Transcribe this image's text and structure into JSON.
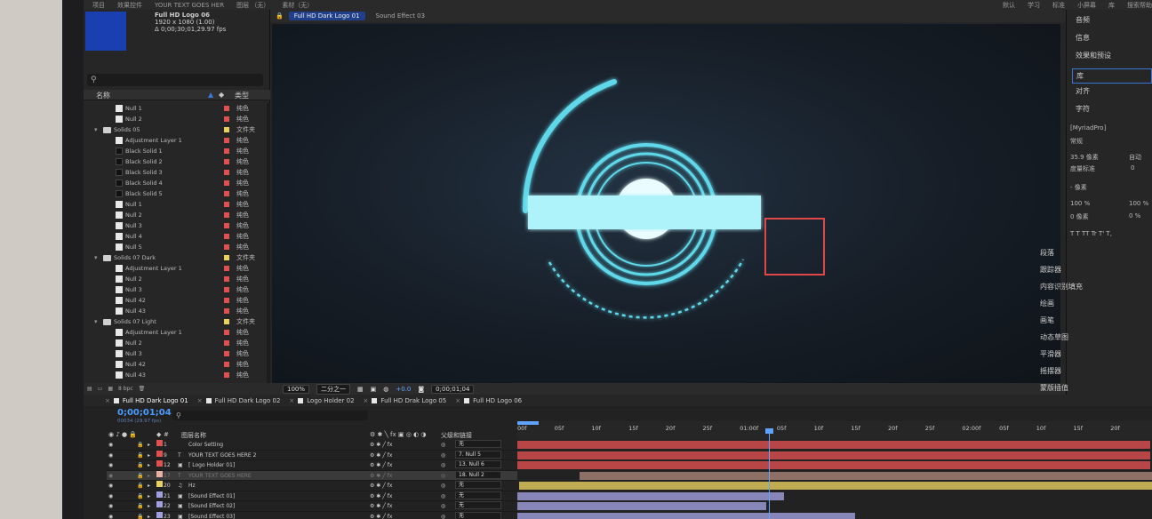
{
  "topbar": {
    "items": [
      "项目",
      "效果控件",
      "YOUR TEXT GOES HER",
      "图层 （无）",
      "素材（无）",
      "默认",
      "学习",
      "标准",
      "小屏幕",
      "库",
      "搜索帮助"
    ]
  },
  "project": {
    "comp_name": "Full HD Logo 06",
    "comp_size": "1920 x 1080 (1.00)",
    "comp_duration": "Δ 0;00;30;01,29.97 fps",
    "search_placeholder": "",
    "col_name": "名称",
    "col_type": "类型",
    "bpc": "8 bpc",
    "items": [
      {
        "indent": 1,
        "kind": "solid",
        "name": "Null 1",
        "color": "#e05050",
        "type": "纯色"
      },
      {
        "indent": 1,
        "kind": "solid",
        "name": "Null 2",
        "color": "#e05050",
        "type": "纯色"
      },
      {
        "indent": 0,
        "kind": "folder",
        "name": "Solids 05",
        "color": "#e8d060",
        "type": "文件夹"
      },
      {
        "indent": 1,
        "kind": "solid",
        "name": "Adjustment Layer 1",
        "color": "#e05050",
        "type": "纯色"
      },
      {
        "indent": 1,
        "kind": "black",
        "name": "Black Solid 1",
        "color": "#e05050",
        "type": "纯色"
      },
      {
        "indent": 1,
        "kind": "black",
        "name": "Black Solid 2",
        "color": "#e05050",
        "type": "纯色"
      },
      {
        "indent": 1,
        "kind": "black",
        "name": "Black Solid 3",
        "color": "#e05050",
        "type": "纯色"
      },
      {
        "indent": 1,
        "kind": "black",
        "name": "Black Solid 4",
        "color": "#e05050",
        "type": "纯色"
      },
      {
        "indent": 1,
        "kind": "black",
        "name": "Black Solid 5",
        "color": "#e05050",
        "type": "纯色"
      },
      {
        "indent": 1,
        "kind": "solid",
        "name": "Null 1",
        "color": "#e05050",
        "type": "纯色"
      },
      {
        "indent": 1,
        "kind": "solid",
        "name": "Null 2",
        "color": "#e05050",
        "type": "纯色"
      },
      {
        "indent": 1,
        "kind": "solid",
        "name": "Null 3",
        "color": "#e05050",
        "type": "纯色"
      },
      {
        "indent": 1,
        "kind": "solid",
        "name": "Null 4",
        "color": "#e05050",
        "type": "纯色"
      },
      {
        "indent": 1,
        "kind": "solid",
        "name": "Null 5",
        "color": "#e05050",
        "type": "纯色"
      },
      {
        "indent": 0,
        "kind": "folder",
        "name": "Solids 07 Dark",
        "color": "#e8d060",
        "type": "文件夹"
      },
      {
        "indent": 1,
        "kind": "solid",
        "name": "Adjustment Layer 1",
        "color": "#e05050",
        "type": "纯色"
      },
      {
        "indent": 1,
        "kind": "solid",
        "name": "Null 2",
        "color": "#e05050",
        "type": "纯色"
      },
      {
        "indent": 1,
        "kind": "solid",
        "name": "Null 3",
        "color": "#e05050",
        "type": "纯色"
      },
      {
        "indent": 1,
        "kind": "solid",
        "name": "Null 42",
        "color": "#e05050",
        "type": "纯色"
      },
      {
        "indent": 1,
        "kind": "solid",
        "name": "Null 43",
        "color": "#e05050",
        "type": "纯色"
      },
      {
        "indent": 0,
        "kind": "folder",
        "name": "Solids 07 Light",
        "color": "#e8d060",
        "type": "文件夹"
      },
      {
        "indent": 1,
        "kind": "solid",
        "name": "Adjustment Layer 1",
        "color": "#e05050",
        "type": "纯色"
      },
      {
        "indent": 1,
        "kind": "solid",
        "name": "Null 2",
        "color": "#e05050",
        "type": "纯色"
      },
      {
        "indent": 1,
        "kind": "solid",
        "name": "Null 3",
        "color": "#e05050",
        "type": "纯色"
      },
      {
        "indent": 1,
        "kind": "solid",
        "name": "Null 42",
        "color": "#e05050",
        "type": "纯色"
      },
      {
        "indent": 1,
        "kind": "solid",
        "name": "Null 43",
        "color": "#e05050",
        "type": "纯色"
      }
    ]
  },
  "composition": {
    "tabs": [
      "Full HD Dark Logo 01",
      "Sound Effect 03"
    ],
    "active_tab": "Full HD Dark Logo 01",
    "zoom": "100%",
    "resolution": "二分之一",
    "exposure": "+0.0",
    "timecode": "0;00;01;04",
    "accent": "#5fd8ea"
  },
  "right_panel": {
    "items": [
      "音频",
      "信息",
      "效果和预设",
      "库",
      "对齐",
      "字符"
    ],
    "selected": "库",
    "font": "[MyriadPro]",
    "style": "常规",
    "size": "35.9 像素",
    "leading": "自动",
    "tracking_label": "度量标准",
    "tracking": "0",
    "stroke": "- 像素",
    "vscale": "100 %",
    "hscale": "100 %",
    "baseline": "0 像素",
    "tsume": "0 %",
    "styles": "T T TT Tr T' T,",
    "panels": [
      "段落",
      "跟踪器",
      "内容识别填充",
      "绘画",
      "画笔",
      "动态草图",
      "平滑器",
      "摇摆器",
      "蒙版插值"
    ]
  },
  "timeline": {
    "tabs": [
      "Full HD Dark Logo 01",
      "Full HD Dark Logo 02",
      "Logo Holder 02",
      "Full HD Drak Logo 05",
      "Full HD Logo 06"
    ],
    "active_tab": "Full HD Dark Logo 01",
    "timecode": "0;00;01;04",
    "fps": "00034 (29.97 fps)",
    "col_layer_name": "图层名称",
    "col_parent": "父级和链接",
    "ruler": [
      "00f",
      "05f",
      "10f",
      "15f",
      "20f",
      "25f",
      "01:00f",
      "05f",
      "10f",
      "15f",
      "20f",
      "25f",
      "02:00f",
      "05f",
      "10f",
      "15f",
      "20f"
    ],
    "layers": [
      {
        "num": "1",
        "label": "#e05050",
        "type": "",
        "name": "Color Setting",
        "parent": "无",
        "sel": false,
        "ghost": false
      },
      {
        "num": "9",
        "label": "#e05050",
        "type": "T",
        "name": "YOUR TEXT GOES HERE 2",
        "parent": "7. Null 5",
        "sel": false,
        "ghost": false
      },
      {
        "num": "12",
        "label": "#e05050",
        "type": "▣",
        "name": "[ Logo Holder 01]",
        "parent": "13. Null 6",
        "sel": false,
        "ghost": false
      },
      {
        "num": "17",
        "label": "#e8b0a0",
        "type": "T",
        "name": "YOUR TEXT GOES HERE",
        "parent": "18. Null 2",
        "sel": true,
        "ghost": true
      },
      {
        "num": "20",
        "label": "#e8d060",
        "type": "♫",
        "name": "Hz",
        "parent": "无",
        "sel": false,
        "ghost": false
      },
      {
        "num": "21",
        "label": "#a0a0e0",
        "type": "▣",
        "name": "[Sound Effect 01]",
        "parent": "无",
        "sel": false,
        "ghost": false
      },
      {
        "num": "22",
        "label": "#a0a0e0",
        "type": "▣",
        "name": "[Sound Effect 02]",
        "parent": "无",
        "sel": false,
        "ghost": false
      },
      {
        "num": "23",
        "label": "#a0a0e0",
        "type": "▣",
        "name": "[Sound Effect 03]",
        "parent": "无",
        "sel": false,
        "ghost": false
      }
    ]
  }
}
